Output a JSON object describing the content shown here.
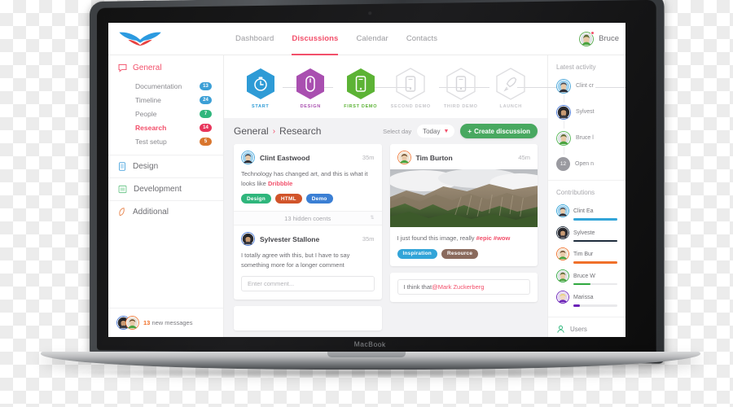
{
  "device": {
    "brand_label": "MacBook"
  },
  "topbar": {
    "logo_name": "bird-logo",
    "nav": [
      {
        "label": "Dashboard",
        "active": false
      },
      {
        "label": "Discussions",
        "active": true
      },
      {
        "label": "Calendar",
        "active": false
      },
      {
        "label": "Contacts",
        "active": false
      }
    ],
    "user": {
      "name": "Bruce",
      "avatar_name": "avatar-bruce"
    }
  },
  "sidebar": {
    "general": {
      "label": "General",
      "icon": "chat-bubble-icon",
      "active": true,
      "links": [
        {
          "label": "Documentation",
          "badge": "13",
          "color": "#3b9fd6",
          "active": false
        },
        {
          "label": "Timeline",
          "badge": "24",
          "color": "#3b9fd6",
          "active": false
        },
        {
          "label": "People",
          "badge": "7",
          "color": "#2fb67c",
          "active": false
        },
        {
          "label": "Research",
          "badge": "14",
          "color": "#e8345a",
          "active": true
        },
        {
          "label": "Test setup",
          "badge": "5",
          "color": "#d9762e",
          "active": false
        }
      ]
    },
    "items": [
      {
        "label": "Design",
        "icon": "mobile-icon",
        "color": "#4aa3dd"
      },
      {
        "label": "Development",
        "icon": "window-icon",
        "color": "#6ec78c"
      },
      {
        "label": "Additional",
        "icon": "leaf-icon",
        "color": "#e8834a"
      }
    ],
    "footer": {
      "count": "13",
      "text": "new messages"
    }
  },
  "stepper": {
    "steps": [
      {
        "label": "START",
        "icon": "stopwatch-icon",
        "color": "#2e9bd6",
        "state": "done"
      },
      {
        "label": "DESIGN",
        "icon": "mouse-icon",
        "color": "#a martial",
        "state": "done"
      },
      {
        "label": "FIRST DEMO",
        "icon": "phone-icon",
        "color": "#5cb335",
        "state": "done"
      },
      {
        "label": "SECOND DEMO",
        "icon": "phone-icon",
        "color": "#d8d8dc",
        "state": "todo"
      },
      {
        "label": "THIRD DEMO",
        "icon": "phone-icon",
        "color": "#d8d8dc",
        "state": "todo"
      },
      {
        "label": "LAUNCH",
        "icon": "rocket-icon",
        "color": "#d8d8dc",
        "state": "todo"
      }
    ],
    "colors": {
      "start": "#2e9bd6",
      "design": "#a council",
      "demo": "#5cb335",
      "inactive": "#d8d8dc"
    }
  },
  "toolbar": {
    "breadcrumb_root": "General",
    "breadcrumb_sep": "›",
    "breadcrumb_current": "Research",
    "select_day_label": "Select day",
    "select_value": "Today",
    "create_label": "Create discussion",
    "create_plus": "+"
  },
  "left_column": {
    "post": {
      "author": "Clint Eastwood",
      "time": "35m",
      "text_before": "Technology has changed art, and this is what it looks like ",
      "highlight": "Dribbble",
      "tags": [
        {
          "label": "Design",
          "color": "#2fb67c"
        },
        {
          "label": "HTML",
          "color": "#d1542a"
        },
        {
          "label": "Demo",
          "color": "#3b7fd4"
        }
      ]
    },
    "hidden_bar": {
      "text": "13 hidden coents",
      "chevron": "chevron-updown-icon"
    },
    "reply": {
      "author": "Sylvester Stallone",
      "time": "35m",
      "text": "I totally agree with this, but I have to say something more for a longer comment"
    },
    "comment_placeholder": "Enter comment..."
  },
  "right_column": {
    "post": {
      "author": "Tim Burton",
      "time": "45m",
      "image_name": "mountain-photo",
      "text_before": "I just found this image, really ",
      "highlight": "#epic #wow",
      "tags": [
        {
          "label": "Inspiration",
          "color": "#32a4d8"
        },
        {
          "label": "Resource",
          "color": "#8a6a5c"
        }
      ]
    },
    "comment": {
      "text_before": "I think that ",
      "mention": "@Mark Zuckerberg"
    }
  },
  "rightbar": {
    "activity_title": "Latest activity",
    "activity": [
      {
        "text": "Clint cr",
        "avatar_name": "avatar-clint",
        "ring": "#3b9fd6"
      },
      {
        "text": "Sylvest",
        "avatar_name": "avatar-sylvester",
        "ring": "#3b6ed4"
      },
      {
        "text": "Bruce l",
        "avatar_name": "avatar-bruce",
        "ring": "#4ab34a"
      },
      {
        "text": "Open n",
        "avatar_name": "count-circle",
        "count": "12"
      }
    ],
    "contributions_title": "Contributions",
    "contributions": [
      {
        "name": "Clint Ea",
        "color": "#32a4d8",
        "pct": 100
      },
      {
        "name": "Sylveste",
        "color": "#1f2d3d",
        "pct": 100
      },
      {
        "name": "Tim Bur",
        "color": "#f0702a",
        "pct": 100
      },
      {
        "name": "Bruce W",
        "color": "#2fa83f",
        "pct": 38
      },
      {
        "name": "Marissa",
        "color": "#6b22b8",
        "pct": 14
      }
    ],
    "footer": {
      "label": "Users",
      "icon": "user-icon",
      "color": "#2fb67c"
    }
  }
}
